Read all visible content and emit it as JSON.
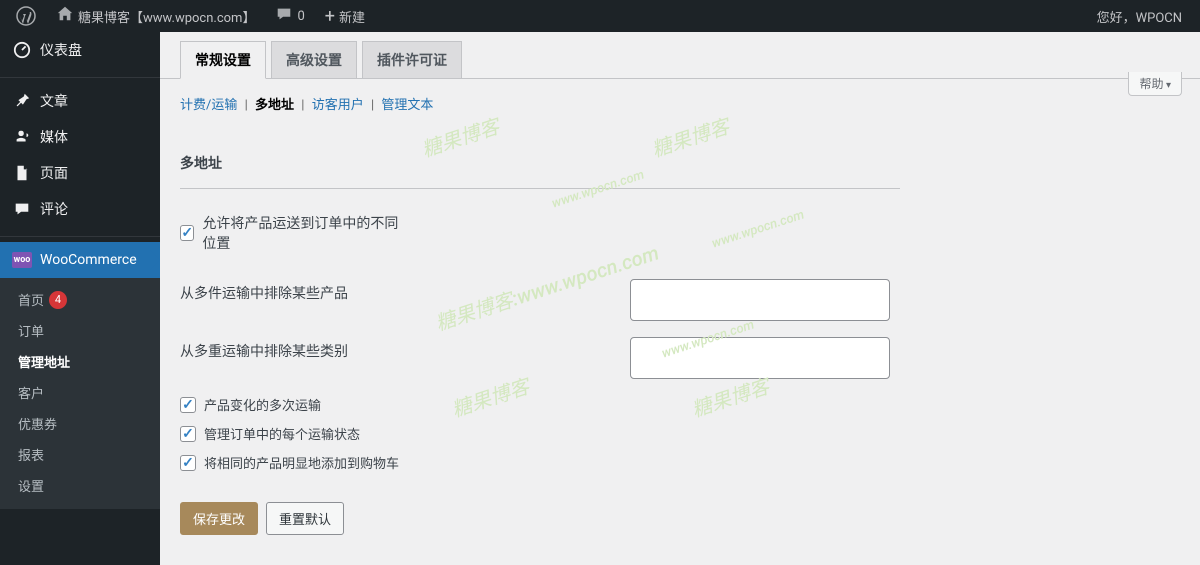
{
  "adminbar": {
    "site_name": "糖果博客【www.wpocn.com】",
    "comments_count": "0",
    "new_label": "新建",
    "greeting": "您好，WPOCN"
  },
  "sidebar": {
    "dashboard": "仪表盘",
    "posts": "文章",
    "media": "媒体",
    "pages": "页面",
    "comments": "评论",
    "woocommerce": "WooCommerce",
    "submenu": {
      "home": "首页",
      "home_badge": "4",
      "orders": "订单",
      "manage_address": "管理地址",
      "customers": "客户",
      "coupons": "优惠券",
      "reports": "报表",
      "settings": "设置"
    }
  },
  "help_button": "帮助",
  "tabs": {
    "general": "常规设置",
    "advanced": "高级设置",
    "license": "插件许可证"
  },
  "subnav": {
    "billing_shipping": "计费/运输",
    "multi_address": "多地址",
    "guest_user": "访客用户",
    "manage_text": "管理文本"
  },
  "section": {
    "title": "多地址",
    "allow_multi_location": "允许将产品运送到订单中的不同位置",
    "exclude_products": "从多件运输中排除某些产品",
    "exclude_categories": "从多重运输中排除某些类别",
    "product_variation": "产品变化的多次运输",
    "manage_shipping_status": "管理订单中的每个运输状态",
    "add_same_product": "将相同的产品明显地添加到购物车"
  },
  "buttons": {
    "save": "保存更改",
    "reset": "重置默认"
  },
  "watermarks": {
    "text1": "糖果博客",
    "text2": "www.wpocn.com",
    "text3": "糖果博客:www.wpocn.com"
  }
}
